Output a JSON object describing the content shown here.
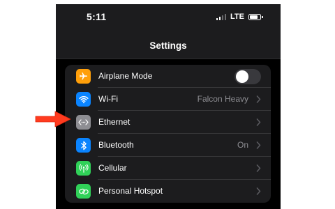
{
  "statusbar": {
    "time": "5:11",
    "carrier": "LTE"
  },
  "nav": {
    "title": "Settings"
  },
  "settings": {
    "items": [
      {
        "label": "Airplane Mode",
        "icon": "airplane-icon",
        "icon_color": "#ff9f0a",
        "toggle_on": false
      },
      {
        "label": "Wi-Fi",
        "detail": "Falcon Heavy",
        "icon": "wifi-icon",
        "icon_color": "#0a84ff"
      },
      {
        "label": "Ethernet",
        "icon": "ethernet-icon",
        "icon_color": "#8e8e93"
      },
      {
        "label": "Bluetooth",
        "detail": "On",
        "icon": "bluetooth-icon",
        "icon_color": "#0a84ff"
      },
      {
        "label": "Cellular",
        "icon": "cellular-icon",
        "icon_color": "#30d158"
      },
      {
        "label": "Personal Hotspot",
        "icon": "hotspot-icon",
        "icon_color": "#30d158"
      }
    ]
  },
  "annotation": {
    "arrow_color": "#ff3b1f"
  }
}
